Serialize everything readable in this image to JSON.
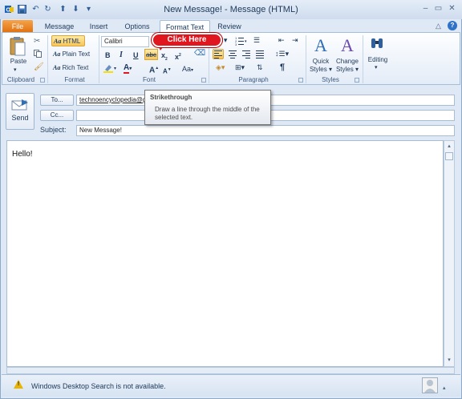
{
  "window": {
    "title": "New Message! - Message (HTML)",
    "minimize_icon": "minimize-icon",
    "maximize_icon": "maximize-icon",
    "close_icon": "close-icon"
  },
  "quick_access": [
    "save-icon",
    "undo-icon",
    "redo-icon",
    "up-arrow-icon",
    "down-arrow-icon",
    "customize-icon"
  ],
  "tabs": [
    {
      "label": "File"
    },
    {
      "label": "Message"
    },
    {
      "label": "Insert"
    },
    {
      "label": "Options"
    },
    {
      "label": "Format Text"
    },
    {
      "label": "Review"
    }
  ],
  "active_tab": "Format Text",
  "ribbon": {
    "clipboard": {
      "group_label": "Clipboard",
      "paste_label": "Paste"
    },
    "format": {
      "group_label": "Format",
      "html_label": "HTML",
      "plain_text_label": "Plain Text",
      "rich_text_label": "Rich Text",
      "aa": "Aa"
    },
    "font": {
      "group_label": "Font",
      "font_name": "Calibri",
      "bold": "B",
      "italic": "I",
      "underline": "U",
      "strike": "abc",
      "subscript": "x",
      "superscript": "x",
      "grow": "A",
      "shrink": "A",
      "change_case": "Aa",
      "font_color": "A"
    },
    "paragraph": {
      "group_label": "Paragraph",
      "pilcrow": "¶"
    },
    "styles": {
      "group_label": "Styles",
      "quick_styles_label": "Quick",
      "quick_styles_label2": "Styles",
      "change_styles_label": "Change",
      "change_styles_label2": "Styles",
      "big_a": "A"
    },
    "editing": {
      "label": "Editing"
    }
  },
  "callout": {
    "text": "Click Here"
  },
  "tooltip": {
    "title": "Strikethrough",
    "body": "Draw a line through the middle of the selected text."
  },
  "message": {
    "send_label": "Send",
    "to_label": "To...",
    "to_value": "technoencyclopedia@gm",
    "cc_label": "Cc...",
    "cc_value": "",
    "subject_label": "Subject:",
    "subject_value": "New Message!",
    "body_text": "Hello!"
  },
  "status": {
    "text": "Windows Desktop Search is not available."
  },
  "colors": {
    "accent_orange": "#e06f0c",
    "callout_red": "#e0171f",
    "ribbon_blue": "#dfe9f5"
  }
}
